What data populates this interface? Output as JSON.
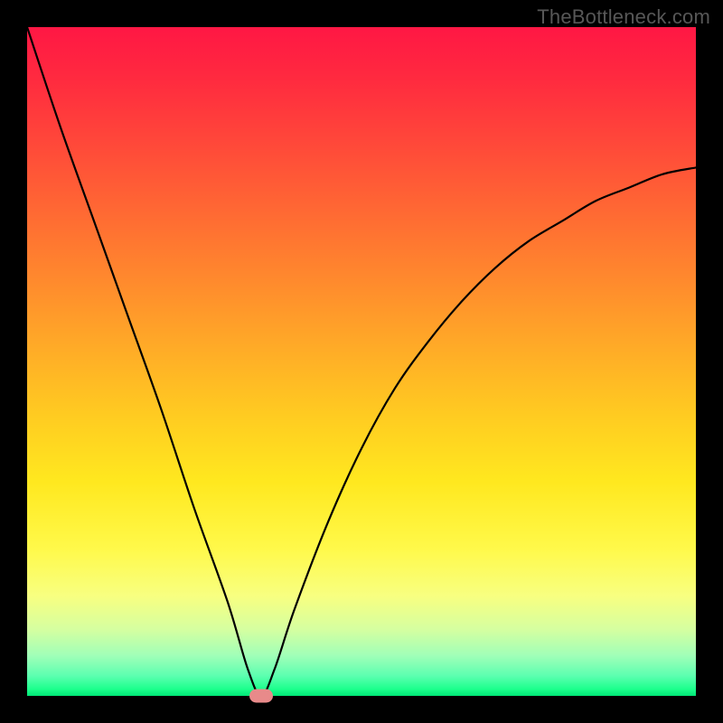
{
  "watermark": "TheBottleneck.com",
  "chart_data": {
    "type": "line",
    "title": "",
    "xlabel": "",
    "ylabel": "",
    "xlim": [
      0,
      100
    ],
    "ylim": [
      0,
      100
    ],
    "note": "V-shaped bottleneck curve on red-to-green vertical gradient. Minimum near x≈35. Left branch from top-left corner down to minimum; right branch rises asymptotically toward upper-right.",
    "series": [
      {
        "name": "bottleneck-curve",
        "x": [
          0,
          5,
          10,
          15,
          20,
          25,
          30,
          33,
          35,
          37,
          40,
          45,
          50,
          55,
          60,
          65,
          70,
          75,
          80,
          85,
          90,
          95,
          100
        ],
        "y": [
          100,
          85,
          71,
          57,
          43,
          28,
          14,
          4,
          0,
          4,
          13,
          26,
          37,
          46,
          53,
          59,
          64,
          68,
          71,
          74,
          76,
          78,
          79
        ]
      }
    ],
    "marker": {
      "x": 35,
      "y": 0,
      "color": "#e88a8a"
    },
    "gradient_stops": [
      {
        "pos": 0,
        "color": "#ff1744"
      },
      {
        "pos": 50,
        "color": "#ffcb21"
      },
      {
        "pos": 85,
        "color": "#f8ff80"
      },
      {
        "pos": 100,
        "color": "#00e676"
      }
    ]
  }
}
